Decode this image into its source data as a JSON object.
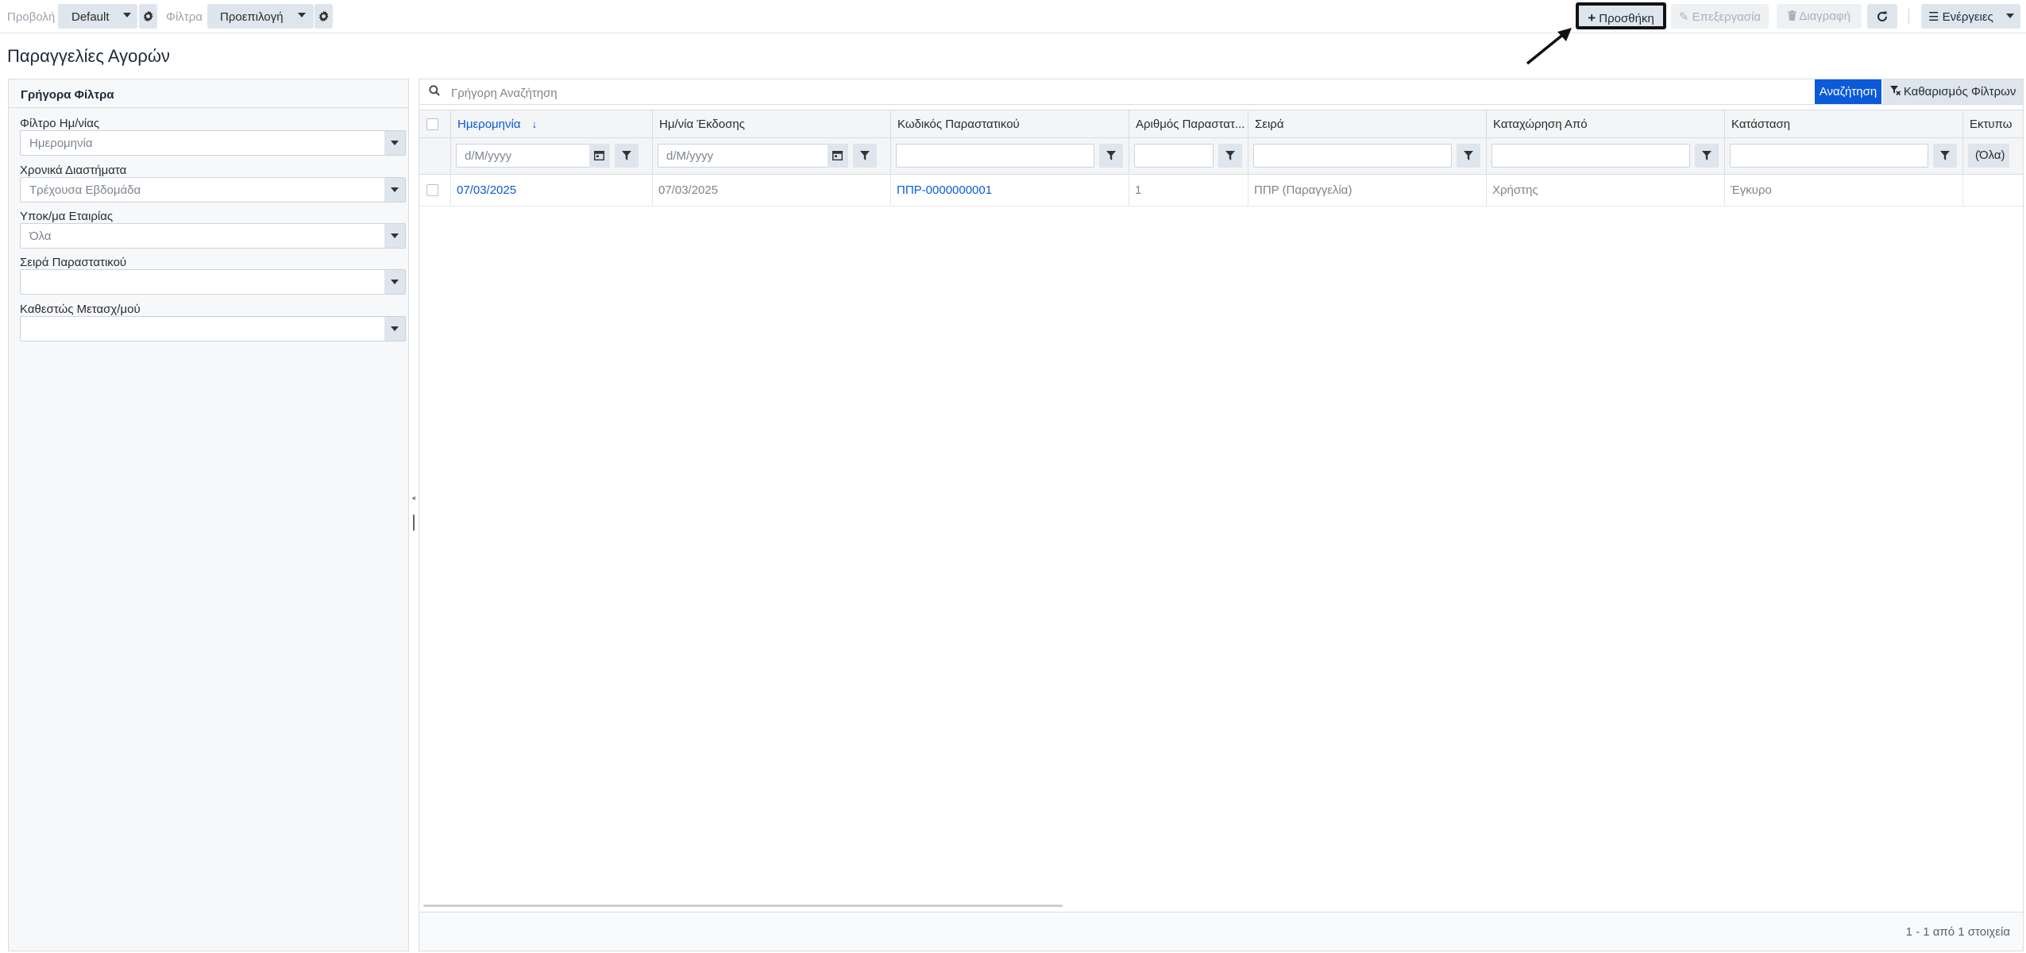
{
  "toolbar": {
    "view_label": "Προβολή",
    "view_value": "Default",
    "filters_label": "Φίλτρα",
    "filters_value": "Προεπιλογή",
    "add_label": "Προσθήκη",
    "edit_label": "Επεξεργασία",
    "delete_label": "Διαγραφή",
    "actions_label": "Ενέργειες"
  },
  "page": {
    "title": "Παραγγελίες Αγορών"
  },
  "quick_filters": {
    "heading": "Γρήγορα Φίλτρα",
    "fields": [
      {
        "label": "Φίλτρο Ημ/νίας",
        "value": "Ημερομηνία"
      },
      {
        "label": "Χρονικά Διαστήματα",
        "value": "Τρέχουσα Εβδομάδα"
      },
      {
        "label": "Υποκ/μα Εταιρίας",
        "value": "Όλα"
      },
      {
        "label": "Σειρά Παραστατικού",
        "value": ""
      },
      {
        "label": "Καθεστώς Μετασχ/μού",
        "value": ""
      }
    ]
  },
  "search": {
    "placeholder": "Γρήγορη Αναζήτηση",
    "search_button": "Αναζήτηση",
    "clear_button": "Καθαρισμός Φίλτρων"
  },
  "grid": {
    "columns": [
      "Ημερομηνία",
      "Ημ/νία Έκδοσης",
      "Κωδικός Παραστατικού",
      "Αριθμός Παραστατ...",
      "Σειρά",
      "Καταχώρηση Από",
      "Κατάσταση",
      "Εκτυπω"
    ],
    "sort_indicator": "↓",
    "date_placeholder": "d/M/yyyy",
    "all_label": "(Όλα)",
    "rows": [
      {
        "date": "07/03/2025",
        "issue_date": "07/03/2025",
        "code": "ΠΠΡ-0000000001",
        "number": "1",
        "series": "ΠΠΡ (Παραγγελία)",
        "entered_by": "Χρήστης",
        "status": "Έγκυρο"
      }
    ],
    "pager_info": "1 - 1 από 1 στοιχεία"
  },
  "colors": {
    "accent": "#0b5ad9",
    "button_bg": "#dfe5ec",
    "border": "#d8dde3"
  }
}
